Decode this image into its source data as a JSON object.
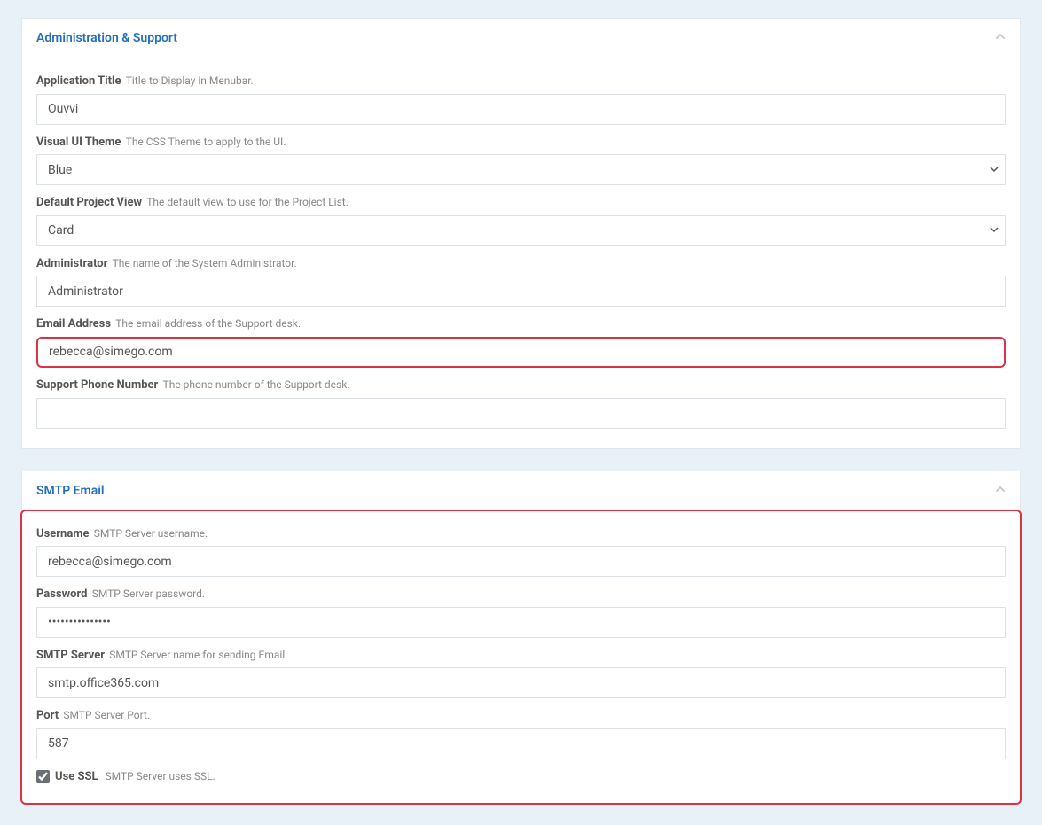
{
  "panels": {
    "admin": {
      "title": "Administration & Support",
      "fields": {
        "app_title": {
          "label": "Application Title",
          "desc": "Title to Display in Menubar.",
          "value": "Ouvvi"
        },
        "theme": {
          "label": "Visual UI Theme",
          "desc": "The CSS Theme to apply to the UI.",
          "value": "Blue"
        },
        "proj_view": {
          "label": "Default Project View",
          "desc": "The default view to use for the Project List.",
          "value": "Card"
        },
        "admin_name": {
          "label": "Administrator",
          "desc": "The name of the System Administrator.",
          "value": "Administrator"
        },
        "email": {
          "label": "Email Address",
          "desc": "The email address of the Support desk.",
          "value": "rebecca@simego.com"
        },
        "phone": {
          "label": "Support Phone Number",
          "desc": "The phone number of the Support desk.",
          "value": ""
        }
      }
    },
    "smtp": {
      "title": "SMTP Email",
      "fields": {
        "username": {
          "label": "Username",
          "desc": "SMTP Server username.",
          "value": "rebecca@simego.com"
        },
        "password": {
          "label": "Password",
          "desc": "SMTP Server password.",
          "value": "•••••••••••••••"
        },
        "server": {
          "label": "SMTP Server",
          "desc": "SMTP Server name for sending Email.",
          "value": "smtp.office365.com"
        },
        "port": {
          "label": "Port",
          "desc": "SMTP Server Port.",
          "value": "587"
        },
        "ssl": {
          "label": "Use SSL",
          "desc": "SMTP Server uses SSL.",
          "checked": true
        }
      }
    }
  }
}
